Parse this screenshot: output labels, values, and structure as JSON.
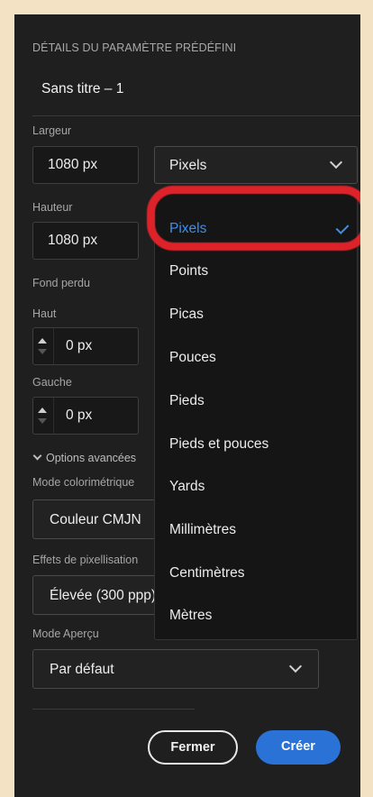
{
  "panel": {
    "section_title": "DÉTAILS DU PARAMÈTRE PRÉDÉFINI",
    "preset_name": "Sans titre – 1"
  },
  "width": {
    "label": "Largeur",
    "value": "1080 px"
  },
  "height": {
    "label": "Hauteur",
    "value": "1080 px"
  },
  "units_select": {
    "value": "Pixels"
  },
  "bleed": {
    "label": "Fond perdu",
    "top": {
      "label": "Haut",
      "value": "0 px"
    },
    "left": {
      "label": "Gauche",
      "value": "0 px"
    }
  },
  "advanced": {
    "toggle_label": "Options avancées",
    "color_mode": {
      "label": "Mode colorimétrique",
      "value": "Couleur CMJN"
    },
    "raster": {
      "label": "Effets de pixellisation",
      "value": "Élevée (300 ppp)"
    },
    "preview": {
      "label": "Mode Aperçu",
      "value": "Par défaut"
    }
  },
  "dropdown": {
    "options": [
      "Pixels",
      "Points",
      "Picas",
      "Pouces",
      "Pieds",
      "Pieds et pouces",
      "Yards",
      "Millimètres",
      "Centimètres",
      "Mètres"
    ],
    "selected": "Pixels"
  },
  "buttons": {
    "close": "Fermer",
    "create": "Créer"
  },
  "colors": {
    "accent": "#3d8fea",
    "primary_button": "#2a72d5",
    "annotation": "#e8232b"
  }
}
